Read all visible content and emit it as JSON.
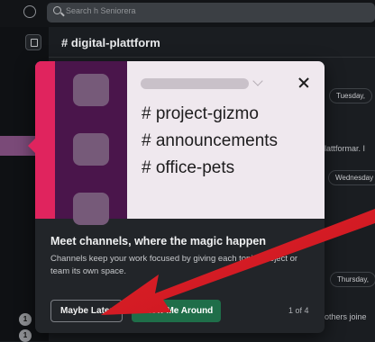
{
  "search": {
    "placeholder": "Search h Seniorera"
  },
  "channel": {
    "name": "# digital-plattform"
  },
  "background": {
    "date_pills": [
      "Tuesday,",
      "Wednesday",
      "Thursday,"
    ],
    "snippet_1": "lattformar. I",
    "snippet_2": "others joine"
  },
  "sidebar": {
    "badges": [
      "1",
      "1"
    ]
  },
  "modal": {
    "hero_lines": [
      "# project-gizmo",
      "# announcements",
      "# office-pets"
    ],
    "title": "Meet channels, where the magic happen",
    "body": "Channels keep your work focused by giving each topic, project or team its own space.",
    "later_label": "Maybe Later",
    "tour_label": "Show Me Around",
    "step_counter": "1 of 4"
  },
  "colors": {
    "modal_bg": "#222529",
    "hero_bg": "#efe8ee",
    "aubergine": "#4a154b",
    "accent_pink": "#e0245e",
    "primary_green": "#1f6e49",
    "annotation_red": "#e0232b"
  }
}
